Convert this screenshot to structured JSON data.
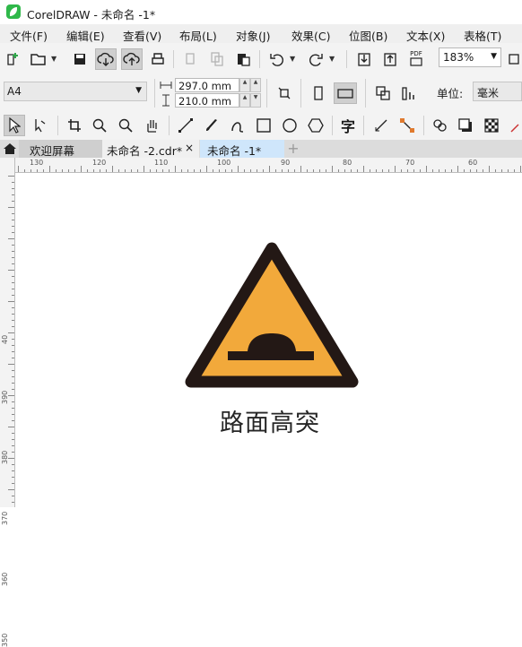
{
  "window": {
    "title": "CorelDRAW - 未命名 -1*"
  },
  "menu": [
    {
      "label": "文件(F)"
    },
    {
      "label": "编辑(E)"
    },
    {
      "label": "查看(V)"
    },
    {
      "label": "布局(L)"
    },
    {
      "label": "对象(J)"
    },
    {
      "label": "效果(C)"
    },
    {
      "label": "位图(B)"
    },
    {
      "label": "文本(X)"
    },
    {
      "label": "表格(T)"
    }
  ],
  "toolbar": {
    "zoom": "183%",
    "pdf_label": "PDF"
  },
  "property_bar": {
    "page_size": "A4",
    "width": "297.0 mm",
    "height": "210.0 mm",
    "units_label": "单位:",
    "units_value": "毫米"
  },
  "tabs": [
    {
      "label": "欢迎屏幕"
    },
    {
      "label": "未命名 -2.cdr*",
      "close": "×"
    },
    {
      "label": "未命名 -1*"
    }
  ],
  "tab_add": "+",
  "ruler": {
    "horizontal": [
      "130",
      "120",
      "110",
      "100",
      "90",
      "80",
      "70",
      "60"
    ],
    "vertical": [
      "40",
      "390",
      "380",
      "370",
      "360",
      "350"
    ]
  },
  "canvas": {
    "sign_caption": "路面高突",
    "sign_colors": {
      "fill": "#f2a93b",
      "stroke": "#231815"
    }
  },
  "toolbox": {
    "text_tool_glyph": "字"
  }
}
